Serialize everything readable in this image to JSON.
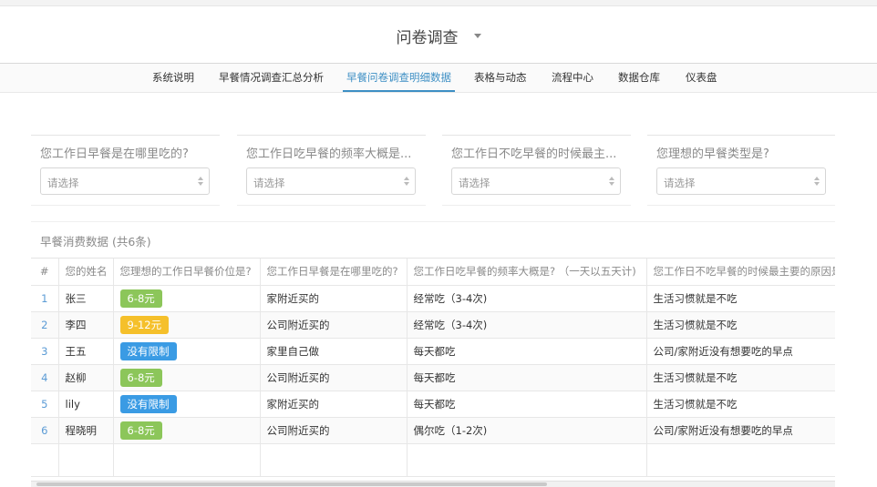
{
  "app": {
    "title": "问卷调查"
  },
  "tabs": [
    {
      "label": "系统说明",
      "active": false
    },
    {
      "label": "早餐情况调查汇总分析",
      "active": false
    },
    {
      "label": "早餐问卷调查明细数据",
      "active": true
    },
    {
      "label": "表格与动态",
      "active": false
    },
    {
      "label": "流程中心",
      "active": false
    },
    {
      "label": "数据仓库",
      "active": false
    },
    {
      "label": "仪表盘",
      "active": false
    }
  ],
  "filters": [
    {
      "label": "您工作日早餐是在哪里吃的?",
      "placeholder": "请选择"
    },
    {
      "label": "您工作日吃早餐的频率大概是...",
      "placeholder": "请选择"
    },
    {
      "label": "您工作日不吃早餐的时候最主...",
      "placeholder": "请选择"
    },
    {
      "label": "您理想的早餐类型是?",
      "placeholder": "请选择"
    }
  ],
  "table": {
    "caption": "早餐消费数据 (共6条)",
    "columns": [
      "#",
      "您的姓名",
      "您理想的工作日早餐价位是?",
      "您工作日早餐是在哪里吃的?",
      "您工作日吃早餐的频率大概是? （一天以五天计)",
      "您工作日不吃早餐的时候最主要的原因是"
    ],
    "rows": [
      {
        "idx": "1",
        "name": "张三",
        "price": "6-8元",
        "price_color": "#8cc65a",
        "where": "家附近买的",
        "freq": "经常吃（3-4次)",
        "reason": "生活习惯就是不吃"
      },
      {
        "idx": "2",
        "name": "李四",
        "price": "9-12元",
        "price_color": "#f5c02b",
        "where": "公司附近买的",
        "freq": "经常吃（3-4次)",
        "reason": "生活习惯就是不吃"
      },
      {
        "idx": "3",
        "name": "王五",
        "price": "没有限制",
        "price_color": "#3a9be4",
        "where": "家里自己做",
        "freq": "每天都吃",
        "reason": "公司/家附近没有想要吃的早点"
      },
      {
        "idx": "4",
        "name": "赵柳",
        "price": "6-8元",
        "price_color": "#8cc65a",
        "where": "公司附近买的",
        "freq": "每天都吃",
        "reason": "生活习惯就是不吃"
      },
      {
        "idx": "5",
        "name": "lily",
        "price": "没有限制",
        "price_color": "#3a9be4",
        "where": "家附近买的",
        "freq": "每天都吃",
        "reason": "生活习惯就是不吃"
      },
      {
        "idx": "6",
        "name": "程晓明",
        "price": "6-8元",
        "price_color": "#8cc65a",
        "where": "公司附近买的",
        "freq": "偶尔吃（1-2次)",
        "reason": "公司/家附近没有想要吃的早点"
      }
    ]
  }
}
